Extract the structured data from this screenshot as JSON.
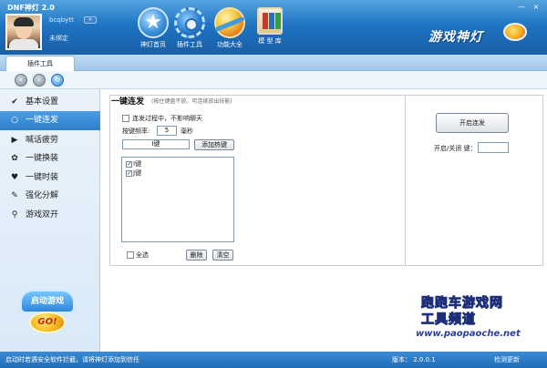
{
  "window": {
    "title": "DNF神灯 2.0",
    "minimize_glyph": "—",
    "close_glyph": "×"
  },
  "user": {
    "name": "bcqbytt",
    "mini_button_label": "»",
    "bind_status": "未绑定"
  },
  "nav": [
    {
      "label": "神灯首页",
      "icon": "star-icon"
    },
    {
      "label": "插件工具",
      "icon": "gear-icon"
    },
    {
      "label": "功能大全",
      "icon": "ball-icon"
    },
    {
      "label": "模 型 库",
      "icon": "library-icon"
    }
  ],
  "brand": {
    "logo_text": "游戏神灯"
  },
  "tab": {
    "label": "插件工具"
  },
  "toolbar": {
    "back_glyph": "‹",
    "forward_glyph": "›",
    "refresh_glyph": "↻"
  },
  "sidebar": {
    "items": [
      {
        "label": "基本设置",
        "icon": "check-icon",
        "glyph": "✔",
        "active": false
      },
      {
        "label": "一键连发",
        "icon": "dot-icon",
        "glyph": "○",
        "active": true
      },
      {
        "label": "喊话疲劳",
        "icon": "triangle-icon",
        "glyph": "▶",
        "active": false
      },
      {
        "label": "一键换装",
        "icon": "paw-icon",
        "glyph": "✿",
        "active": false
      },
      {
        "label": "一键时装",
        "icon": "heart-icon",
        "glyph": "♥",
        "active": false
      },
      {
        "label": "强化分解",
        "icon": "wrench-icon",
        "glyph": "✎",
        "active": false
      },
      {
        "label": "游戏双开",
        "icon": "search-icon",
        "glyph": "⚲",
        "active": false
      }
    ],
    "launch_label": "启动游戏",
    "go_label": "GO!"
  },
  "main": {
    "title": "一键连发",
    "hint": "(按住键盘不放，可连续放出技能)",
    "chat_checkbox_label": "连发过程中，不影响聊天",
    "chat_checked": false,
    "freq_label": "按键频率:",
    "freq_value": "5",
    "freq_unit": "毫秒",
    "key_input_value": "I键",
    "add_hotkey_label": "添加热键",
    "key_list": [
      {
        "label": "I键",
        "checked": true
      },
      {
        "label": "J键",
        "checked": true
      }
    ],
    "select_all_label": "全选",
    "delete_label": "删除",
    "clear_label": "清空",
    "start_button_label": "开启连发",
    "toggle_key_label": "开启/关闭 键：",
    "toggle_key_value": ""
  },
  "watermark": {
    "line1": "跑跑车游戏网",
    "line2": "工具频道",
    "url": "www.paopaoche.net"
  },
  "status": {
    "message": "启动时若遇安全软件拦截，请将神灯添加到信任",
    "version": "版本： 2.0.0.1",
    "update_label": "检测更新"
  }
}
